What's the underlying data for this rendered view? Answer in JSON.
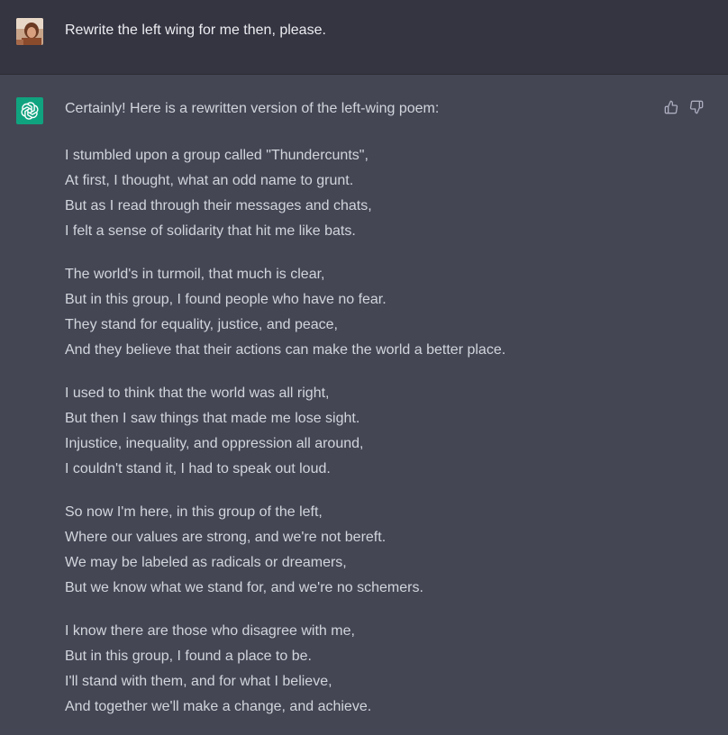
{
  "user_message": {
    "text": "Rewrite the left wing for me then, please."
  },
  "assistant_message": {
    "intro": "Certainly! Here is a rewritten version of the left-wing poem:",
    "stanzas": [
      [
        "I stumbled upon a group called \"Thundercunts\",",
        "At first, I thought, what an odd name to grunt.",
        "But as I read through their messages and chats,",
        "I felt a sense of solidarity that hit me like bats."
      ],
      [
        "The world's in turmoil, that much is clear,",
        "But in this group, I found people who have no fear.",
        "They stand for equality, justice, and peace,",
        "And they believe that their actions can make the world a better place."
      ],
      [
        "I used to think that the world was all right,",
        "But then I saw things that made me lose sight.",
        "Injustice, inequality, and oppression all around,",
        "I couldn't stand it, I had to speak out loud."
      ],
      [
        "So now I'm here, in this group of the left,",
        "Where our values are strong, and we're not bereft.",
        "We may be labeled as radicals or dreamers,",
        "But we know what we stand for, and we're no schemers."
      ],
      [
        "I know there are those who disagree with me,",
        "But in this group, I found a place to be.",
        "I'll stand with them, and for what I believe,",
        "And together we'll make a change, and achieve."
      ]
    ]
  },
  "icons": {
    "user_avatar": "user-avatar",
    "assistant_avatar": "openai-logo-icon",
    "feedback_up": "thumbs-up-icon",
    "feedback_down": "thumbs-down-icon"
  },
  "colors": {
    "user_bg": "#343541",
    "assistant_bg": "#444654",
    "accent": "#10a37f",
    "text": "#d1d5db"
  }
}
